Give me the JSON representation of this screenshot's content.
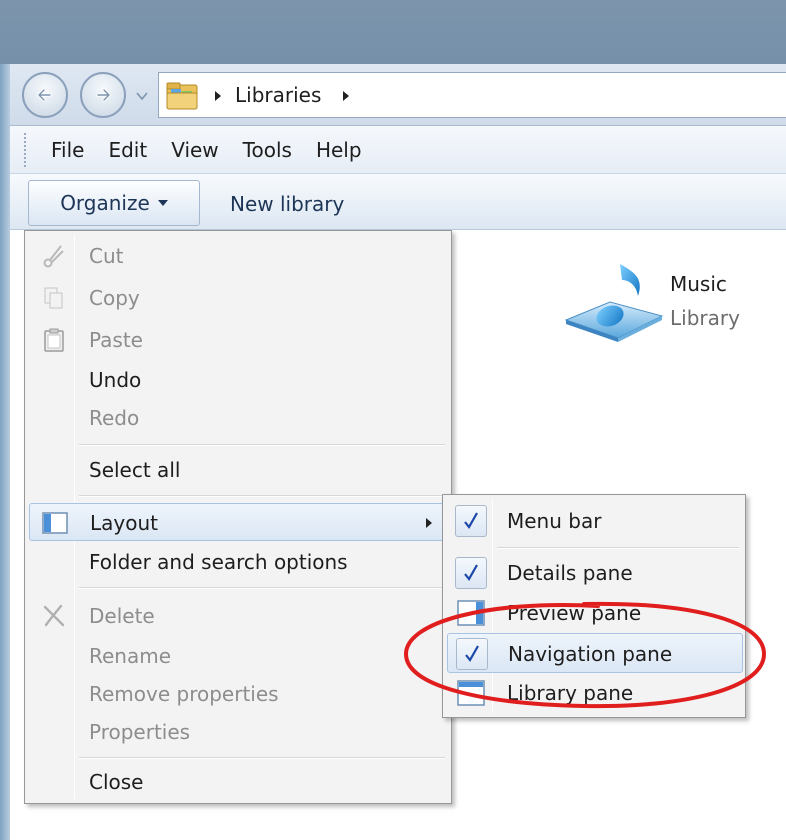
{
  "address": {
    "breadcrumb": "Libraries"
  },
  "menubar": {
    "items": [
      "File",
      "Edit",
      "View",
      "Tools",
      "Help"
    ]
  },
  "toolbar": {
    "organize_label": "Organize",
    "new_library_label": "New library"
  },
  "library": {
    "name": "Music",
    "type": "Library"
  },
  "organize_menu": {
    "items": [
      {
        "label": "Cut",
        "icon": "scissors-icon",
        "enabled": false
      },
      {
        "label": "Copy",
        "icon": "copy-icon",
        "enabled": false
      },
      {
        "label": "Paste",
        "icon": "clipboard-icon",
        "enabled": false
      },
      {
        "label": "Undo",
        "enabled": true
      },
      {
        "label": "Redo",
        "enabled": false
      },
      {
        "label": "Select all",
        "enabled": true
      },
      {
        "label": "Layout",
        "icon": "layout-icon",
        "enabled": true,
        "has_submenu": true
      },
      {
        "label": "Folder and search options",
        "enabled": true
      },
      {
        "label": "Delete",
        "icon": "delete-x-icon",
        "enabled": false
      },
      {
        "label": "Rename",
        "enabled": false
      },
      {
        "label": "Remove properties",
        "enabled": false
      },
      {
        "label": "Properties",
        "enabled": false
      },
      {
        "label": "Close",
        "enabled": true
      }
    ]
  },
  "layout_submenu": {
    "items": [
      {
        "label": "Menu bar",
        "checked": true
      },
      {
        "label": "Details pane",
        "checked": true
      },
      {
        "label": "Preview pane",
        "checked": false,
        "icon": "preview-pane-icon"
      },
      {
        "label": "Navigation pane",
        "checked": true,
        "highlighted": true
      },
      {
        "label": "Library pane",
        "checked": false,
        "icon": "library-pane-icon"
      }
    ]
  },
  "colors": {
    "annotation": "#e01e1e",
    "checkmark": "#1b47a8",
    "disabled_text": "#8d8d8d"
  }
}
